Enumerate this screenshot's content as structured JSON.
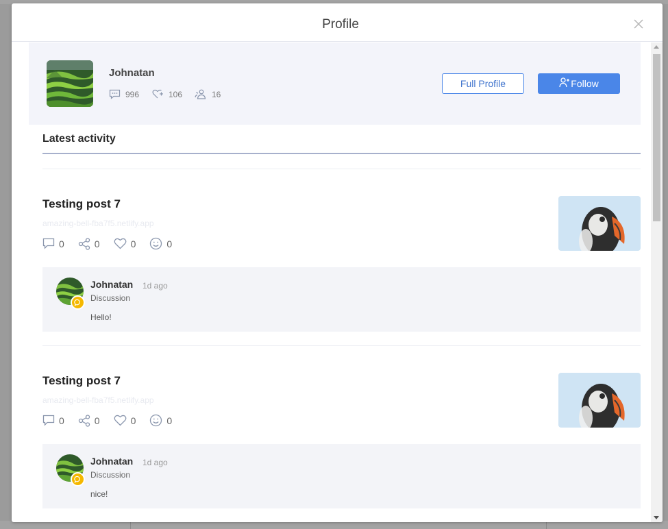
{
  "modal": {
    "title": "Profile"
  },
  "profile": {
    "name": "Johnatan",
    "stats": {
      "comments": "996",
      "likes": "106",
      "followers": "16"
    },
    "full_profile_label": "Full Profile",
    "follow_label": "Follow"
  },
  "activity": {
    "title": "Latest activity",
    "posts": [
      {
        "title": "Testing post 7",
        "url": "amazing-bell-fba7f5.netlify.app",
        "comments": "0",
        "shares": "0",
        "likes": "0",
        "reactions": "0",
        "comment": {
          "author": "Johnatan",
          "time": "1d ago",
          "type": "Discussion",
          "text": "Hello!"
        }
      },
      {
        "title": "Testing post 7",
        "url": "amazing-bell-fba7f5.netlify.app",
        "comments": "0",
        "shares": "0",
        "likes": "0",
        "reactions": "0",
        "comment": {
          "author": "Johnatan",
          "time": "1d ago",
          "type": "Discussion",
          "text": "nice!"
        }
      }
    ]
  },
  "icons": {
    "close": "close-icon",
    "comments": "comment-icon",
    "likes": "heart-plus-icon",
    "followers": "users-icon",
    "follow": "user-plus-icon",
    "share": "share-icon",
    "heart": "heart-icon",
    "smile": "smile-icon",
    "badge": "chat-bubble-icon"
  },
  "colors": {
    "accent": "#4a86e8",
    "badge": "#f5b800",
    "card_bg": "#f3f4fa",
    "rule": "#a7b0cc"
  }
}
